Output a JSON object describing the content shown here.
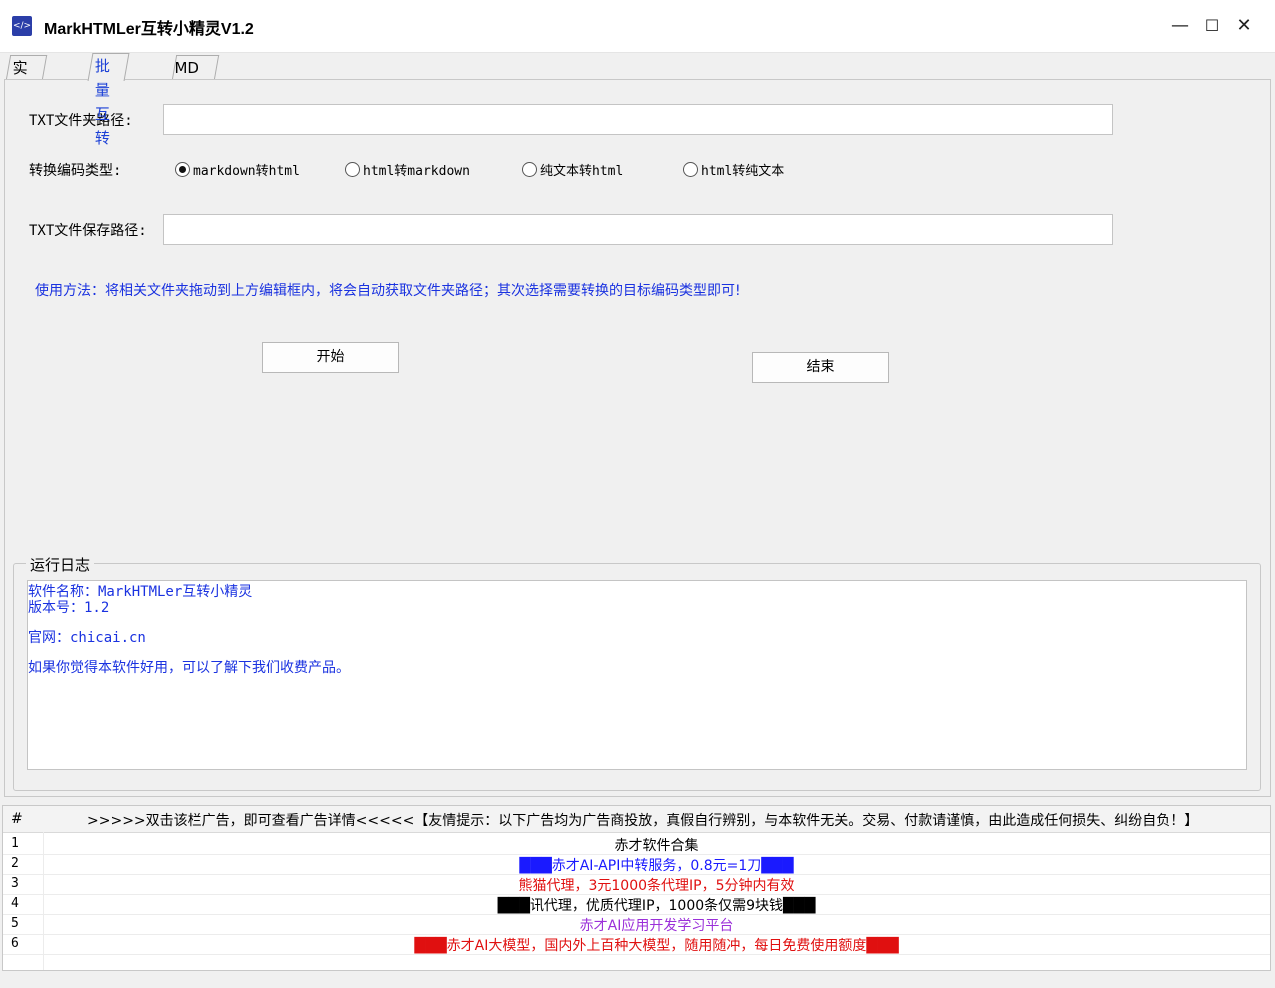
{
  "window": {
    "title": "MarkHTMLer互转小精灵V1.2",
    "minimize": "—",
    "maximize": "☐",
    "close": "✕",
    "icon": "app-icon"
  },
  "tabs": [
    {
      "label": "实时互转"
    },
    {
      "label": "批量互转"
    },
    {
      "label": "MD解析接口"
    }
  ],
  "form": {
    "folder_label": "TXT文件夹路径:",
    "folder_value": "",
    "type_label": "转换编码类型:",
    "options": [
      {
        "label": "markdown转html",
        "checked": true
      },
      {
        "label": "html转markdown",
        "checked": false
      },
      {
        "label": "纯文本转html",
        "checked": false
      },
      {
        "label": "html转纯文本",
        "checked": false
      }
    ],
    "save_label": "TXT文件保存路径:",
    "save_value": "",
    "hint": "使用方法：将相关文件夹拖动到上方编辑框内，将会自动获取文件夹路径；其次选择需要转换的目标编码类型即可!",
    "start_button": "开始",
    "end_button": "结束"
  },
  "log": {
    "title": "运行日志",
    "lines": [
      "软件名称：MarkHTMLer互转小精灵",
      "版本号：1.2",
      "官网：chicai.cn",
      "如果你觉得本软件好用，可以了解下我们收费产品。"
    ]
  },
  "ads": {
    "header_hash": "#",
    "header_text": ">>>>>双击该栏广告，即可查看广告详情<<<<<【友情提示：以下广告均为广告商投放，真假自行辨别，与本软件无关。交易、付款请谨慎，由此造成任何损失、纠纷自负！】",
    "rows": [
      {
        "num": "1",
        "text": "赤才软件合集",
        "color": "#000000",
        "style": "plain"
      },
      {
        "num": "2",
        "text": "赤才AI-API中转服务，0.8元=1刀",
        "color": "#1a1aff",
        "style": "blue-blocks"
      },
      {
        "num": "3",
        "text": "熊猫代理，3元1000条代理IP，5分钟内有效",
        "color": "#e01010",
        "style": "plain"
      },
      {
        "num": "4",
        "text": "讯代理，优质代理IP，1000条仅需9块钱",
        "color": "#000000",
        "style": "black-blocks"
      },
      {
        "num": "5",
        "text": "赤才AI应用开发学习平台",
        "color": "#9b30d9",
        "style": "plain"
      },
      {
        "num": "6",
        "text": "赤才AI大模型，国内外上百种大模型，随用随冲，每日免费使用额度",
        "color": "#e01010",
        "style": "red-blocks"
      }
    ]
  }
}
